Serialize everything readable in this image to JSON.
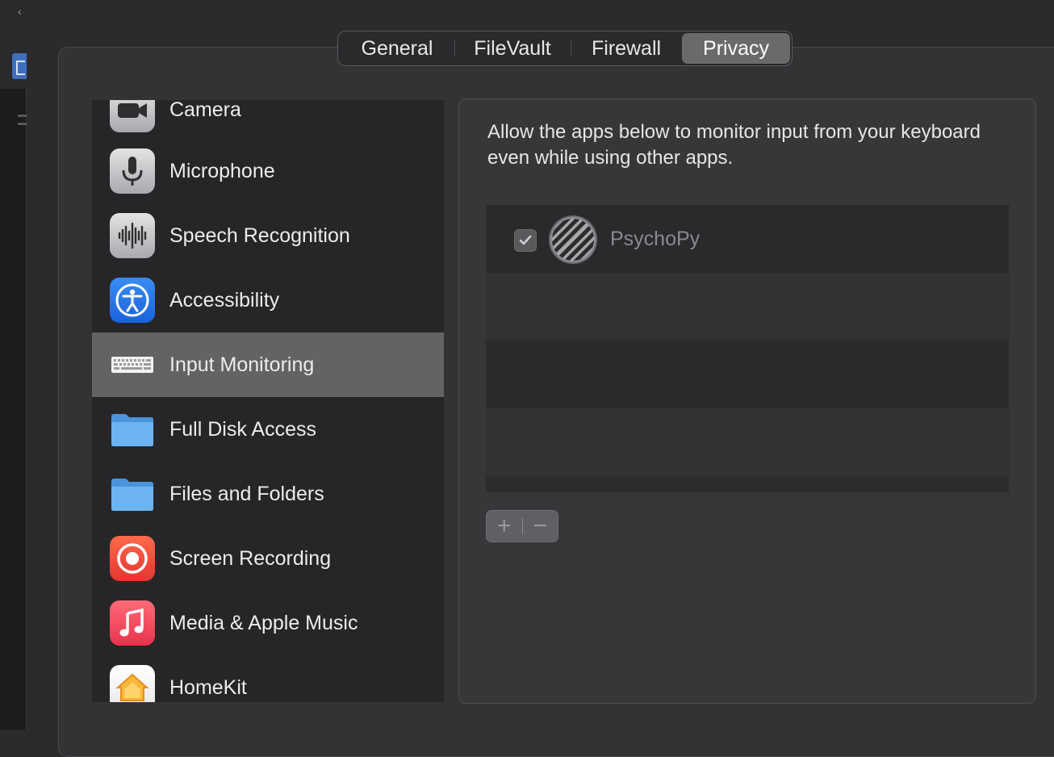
{
  "tabs": [
    {
      "label": "General",
      "active": false
    },
    {
      "label": "FileVault",
      "active": false
    },
    {
      "label": "Firewall",
      "active": false
    },
    {
      "label": "Privacy",
      "active": true
    }
  ],
  "sidebar": {
    "items": [
      {
        "label": "Camera",
        "icon": "camera-icon"
      },
      {
        "label": "Microphone",
        "icon": "microphone-icon"
      },
      {
        "label": "Speech Recognition",
        "icon": "waveform-icon"
      },
      {
        "label": "Accessibility",
        "icon": "accessibility-icon"
      },
      {
        "label": "Input Monitoring",
        "icon": "keyboard-icon",
        "selected": true
      },
      {
        "label": "Full Disk Access",
        "icon": "folder-icon"
      },
      {
        "label": "Files and Folders",
        "icon": "folder-icon"
      },
      {
        "label": "Screen Recording",
        "icon": "record-icon"
      },
      {
        "label": "Media & Apple Music",
        "icon": "music-note-icon"
      },
      {
        "label": "HomeKit",
        "icon": "home-icon"
      }
    ]
  },
  "detail": {
    "description": "Allow the apps below to monitor input from your keyboard even while using other apps.",
    "apps": [
      {
        "name": "PsychoPy",
        "checked": true,
        "icon": "psychopy-icon"
      }
    ]
  },
  "controls": {
    "add_label": "+",
    "remove_label": "−"
  },
  "colors": {
    "selected_row": "#636366",
    "accessibility_blue": "#1a62dd",
    "screen_recording_red": "#e2362f",
    "music_pink": "#e8324c"
  }
}
